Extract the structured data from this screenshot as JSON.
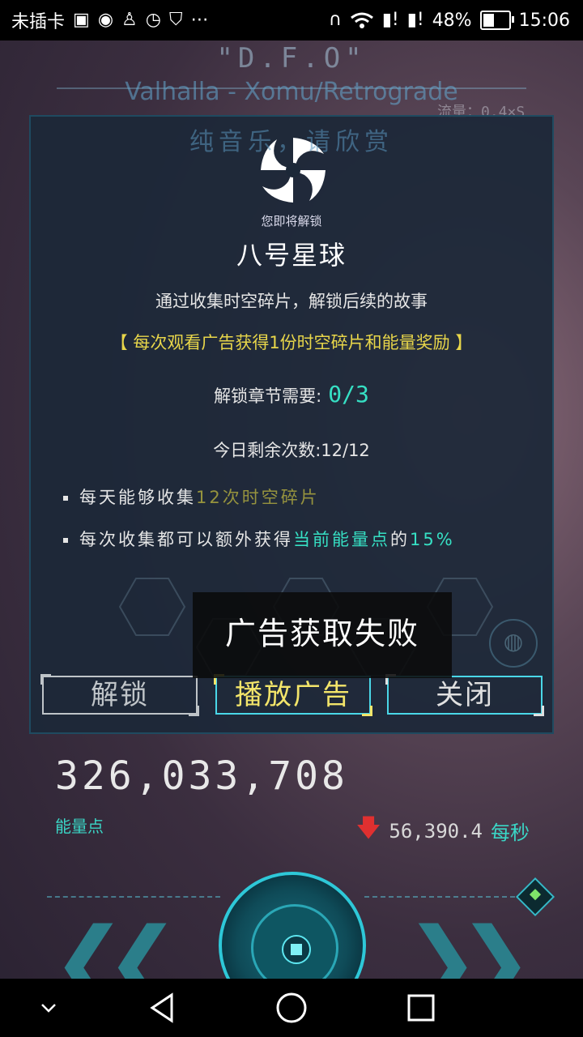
{
  "status_bar": {
    "carrier": "未插卡",
    "battery_percent": "48%",
    "battery_level": 0.48,
    "time": "15:06",
    "icons_left": [
      "no-sim-text",
      "image-icon",
      "weibo-icon",
      "qq-icon",
      "timer-icon",
      "shield-icon",
      "more-icon"
    ],
    "icons_right": [
      "headphones-icon",
      "wifi-icon",
      "sim1-alert-icon",
      "sim2-alert-icon",
      "battery-icon"
    ]
  },
  "background": {
    "game_title": "\"D.F.O\"",
    "song": "Valhalla - Xomu/Retrograde",
    "flow_label": "流量：0.4×S",
    "pure_music": "纯音乐，请欣赏"
  },
  "dialog": {
    "about_to_unlock": "您即将解锁",
    "planet_name": "八号星球",
    "description": "通过收集时空碎片，解锁后续的故事",
    "reward_note": "【 每次观看广告获得1份时空碎片和能量奖励 】",
    "chapter_need_label": "解锁章节需要:",
    "chapter_need_value": "0/3",
    "remaining_today": "今日剩余次数:12/12",
    "bullet1_pre": "每天能够收集",
    "bullet1_hl": "12次时空碎片",
    "bullet2_pre": "每次收集都可以额外获得",
    "bullet2_hl": "当前能量点",
    "bullet2_post": "的",
    "bullet2_pct": "15%",
    "buttons": {
      "unlock": "解锁",
      "play_ad": "播放广告",
      "close": "关闭"
    }
  },
  "toast": {
    "message": "广告获取失败"
  },
  "energy": {
    "value": "326,033,708",
    "label": "能量点",
    "rate_value": "56,390.4",
    "rate_unit": "每秒"
  },
  "colors": {
    "accent_teal": "#36e0c4",
    "highlight_yellow": "#e8d64a",
    "down_arrow_red": "#e03030",
    "dialog_bg": "#1c2838"
  }
}
